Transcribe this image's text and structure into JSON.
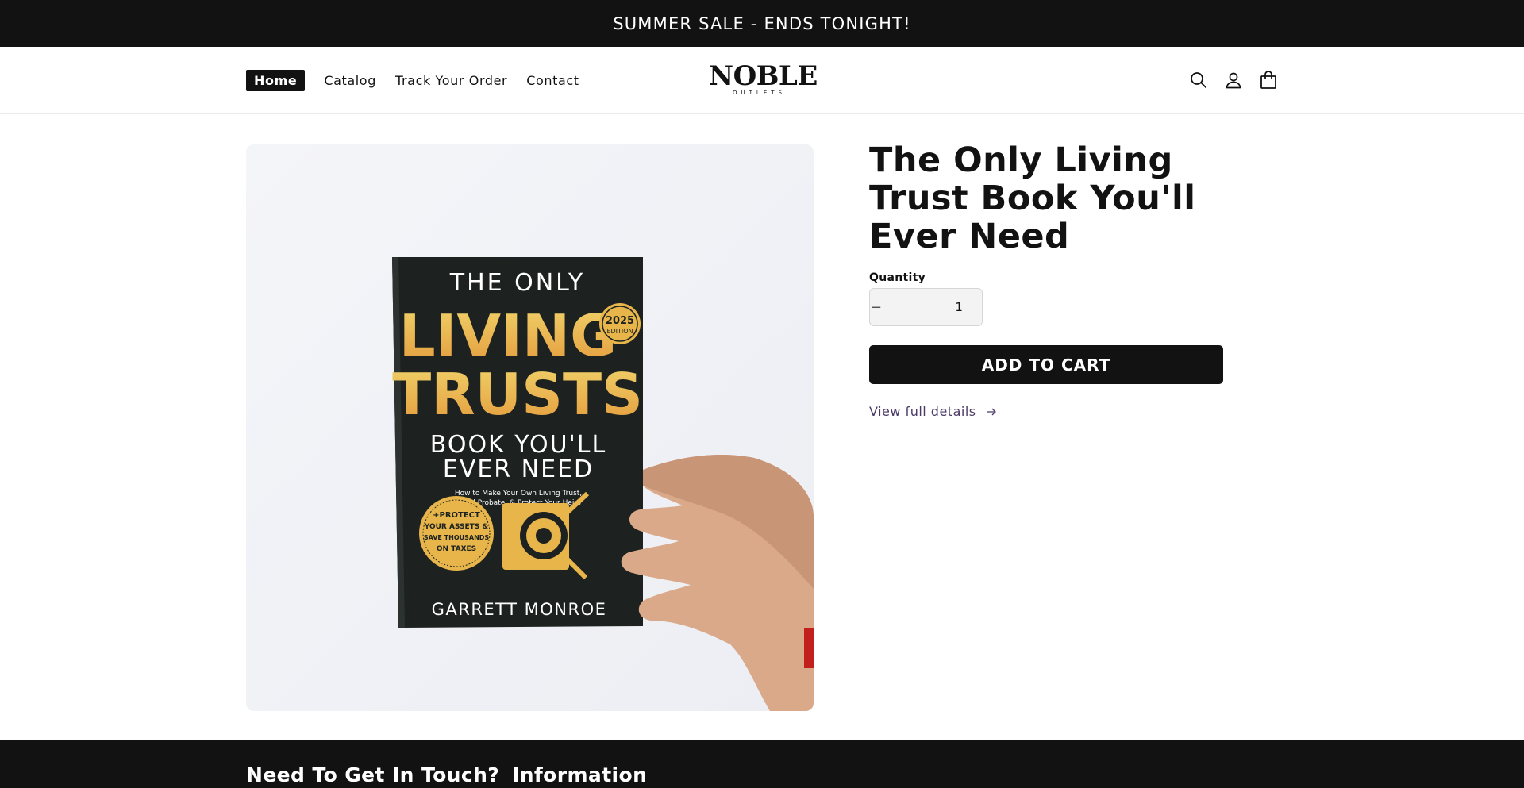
{
  "announcement": {
    "text": "SUMMER SALE - ENDS TONIGHT!"
  },
  "nav": {
    "items": [
      {
        "label": "Home",
        "active": true
      },
      {
        "label": "Catalog",
        "active": false
      },
      {
        "label": "Track Your Order",
        "active": false
      },
      {
        "label": "Contact",
        "active": false
      }
    ]
  },
  "logo": {
    "main": "NOBLE",
    "sub": "OUTLETS"
  },
  "header_icons": [
    "search-icon",
    "account-icon",
    "cart-icon"
  ],
  "product": {
    "title": "The Only Living Trust Book You'll Ever Need",
    "quantity_label": "Quantity",
    "quantity_value": "1",
    "decrease_symbol": "−",
    "increase_symbol": "+",
    "add_to_cart": "ADD TO CART",
    "view_details": "View full details",
    "image": {
      "cover_line1": "THE ONLY",
      "cover_line2": "LIVING",
      "cover_line3": "TRUSTS",
      "cover_line4": "BOOK YOU'LL",
      "cover_line5": "EVER NEED",
      "cover_subtitle1": "How to Make Your Own Living Trust,",
      "cover_subtitle2": "Avoid Probate, & Protect Your Heirs",
      "badge_line1": "2025",
      "badge_line2": "EDITION",
      "seal_line1": "+PROTECT",
      "seal_line2": "YOUR ASSETS &",
      "seal_line3": "SAVE THOUSANDS",
      "seal_line4": "ON TAXES",
      "author": "GARRETT MONROE"
    }
  },
  "footer": {
    "headings": [
      "Need To Get In Touch?",
      "Information"
    ]
  },
  "colors": {
    "dark": "#121212",
    "link": "#4b3a66",
    "gold": "#e7b54a"
  }
}
